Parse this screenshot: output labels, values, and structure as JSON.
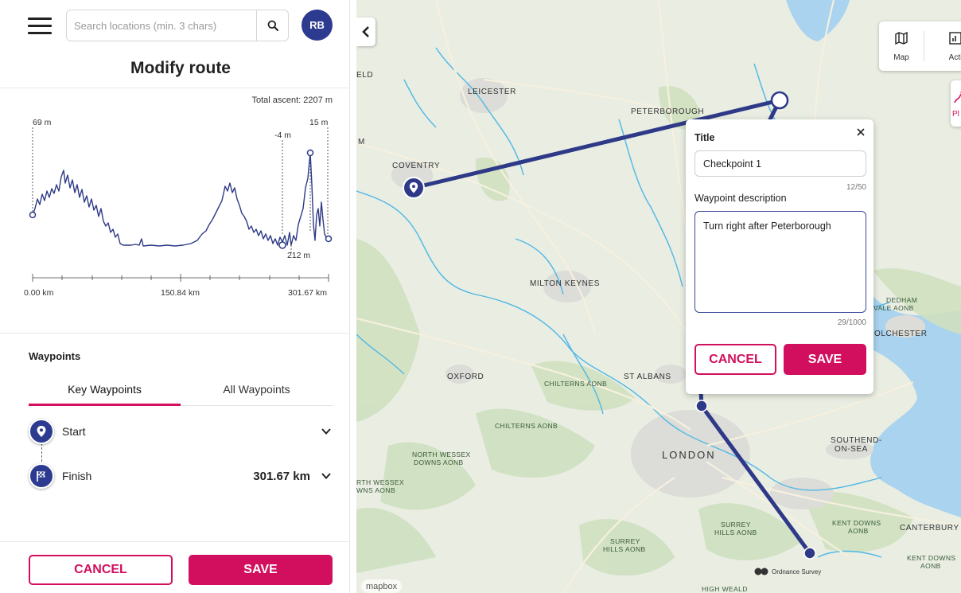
{
  "header": {
    "search_placeholder": "Search locations (min. 3 chars)",
    "avatar_initials": "RB",
    "title": "Modify route"
  },
  "elevation": {
    "total_ascent": "Total ascent: 2207 m",
    "markers": {
      "start": "69 m",
      "low_point": "-4 m",
      "peak": "15 m",
      "bottom": "212 m"
    },
    "axis_ticks": [
      "0.00 km",
      "150.84 km",
      "301.67 km"
    ]
  },
  "waypoints": {
    "heading": "Waypoints",
    "tabs": [
      {
        "label": "Key Waypoints",
        "active": true
      },
      {
        "label": "All Waypoints",
        "active": false
      }
    ],
    "items": [
      {
        "name": "Start",
        "distance": "",
        "icon": "pin-icon"
      },
      {
        "name": "Finish",
        "distance": "301.67 km",
        "icon": "checkered-flag-icon"
      }
    ]
  },
  "footer": {
    "cancel_label": "CANCEL",
    "save_label": "SAVE"
  },
  "map": {
    "tools": [
      {
        "label": "Map",
        "icon": "map-icon"
      },
      {
        "label": "Activit",
        "icon": "activity-chart-icon"
      }
    ],
    "plan_tool_label": "Pl",
    "places": {
      "leicester": "LEICESTER",
      "peterborough": "PETERBOROUGH",
      "coventry": "COVENTRY",
      "milton_keynes": "MILTON KEYNES",
      "oxford": "OXFORD",
      "st_albans": "ST ALBANS",
      "london": "LONDON",
      "canterbury": "CANTERBURY",
      "colchester": "OLCHESTER",
      "southend_1": "SOUTHEND-",
      "southend_2": "ON-SEA",
      "eld": "ELD",
      "m": "M"
    },
    "aonbs": {
      "chilterns_1": "CHILTERNS AONB",
      "chilterns_2": "CHILTERNS AONB",
      "north_wessex_1": "NORTH WESSEX",
      "north_wessex_2": "DOWNS AONB",
      "north_wessex_b1": "RTH WESSEX",
      "north_wessex_b2": "WNS AONB",
      "surrey_1": "SURREY",
      "surrey_2": "HILLS AONB",
      "surrey_b1": "SURREY",
      "surrey_b2": "HILLS AONB",
      "kent_1": "KENT DOWNS",
      "kent_2": "AONB",
      "kent_b1": "KENT DOWNS",
      "kent_b2": "AONB",
      "dedham_1": "DEDHAM",
      "dedham_2": "VALE AONB",
      "high_weald": "HIGH WEALD"
    },
    "attribution": "mapbox",
    "os_attribution": "Ordnance Survey",
    "colors": {
      "route": "#2e3a87",
      "accent": "#d10f5e",
      "water": "#4fb8e6"
    }
  },
  "popup": {
    "title_label": "Title",
    "title_value": "Checkpoint 1",
    "title_counter": "12/50",
    "desc_label": "Waypoint description",
    "desc_value": "Turn right after Peterborough",
    "desc_counter": "29/1000",
    "cancel_label": "CANCEL",
    "save_label": "SAVE"
  }
}
